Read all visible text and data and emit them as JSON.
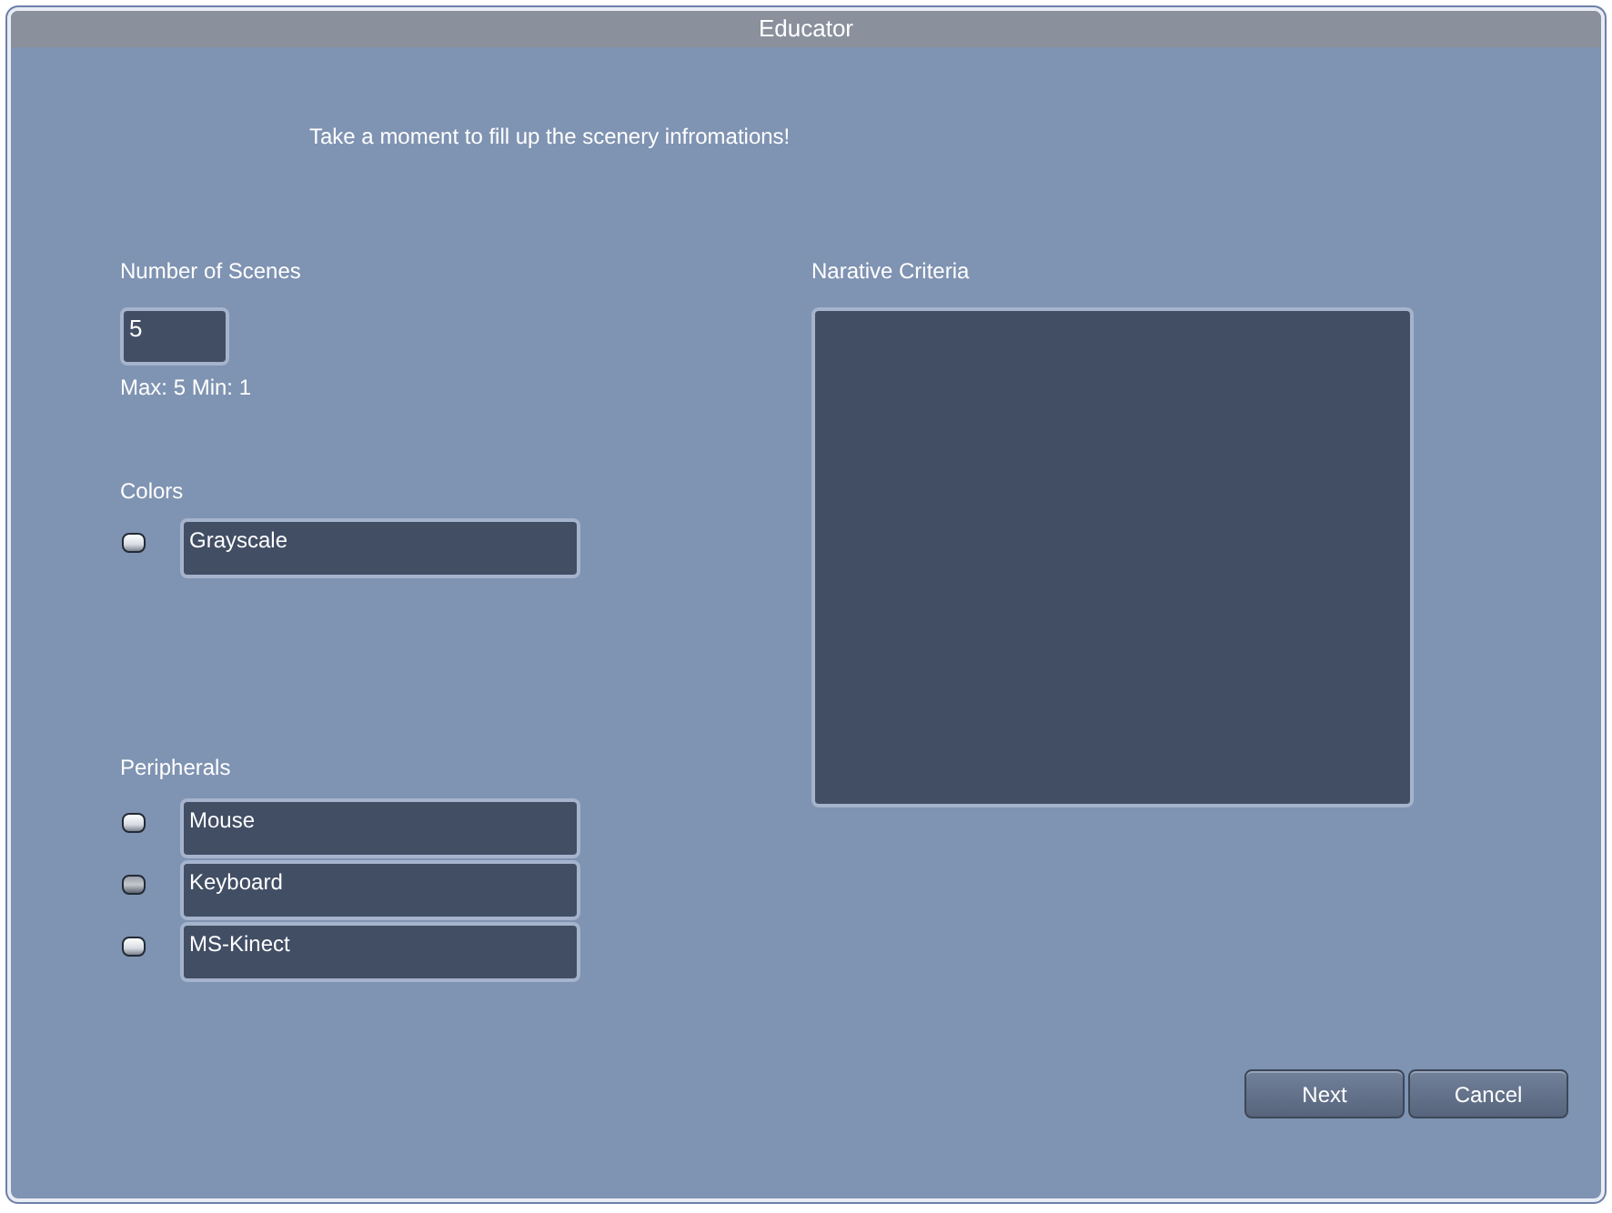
{
  "window": {
    "title": "Educator"
  },
  "intro": "Take a moment to fill up the scenery infromations!",
  "scenes": {
    "label": "Number of Scenes",
    "value": "5",
    "hint": "Max: 5 Min: 1"
  },
  "colors": {
    "label": "Colors",
    "items": [
      {
        "label": "Grayscale",
        "checked": true
      }
    ]
  },
  "peripherals": {
    "label": "Peripherals",
    "items": [
      {
        "label": "Mouse",
        "checked": true
      },
      {
        "label": "Keyboard",
        "checked": false
      },
      {
        "label": "MS-Kinect",
        "checked": true
      }
    ]
  },
  "narrative": {
    "label": "Narative Criteria"
  },
  "buttons": [
    "Next",
    "Cancel"
  ]
}
